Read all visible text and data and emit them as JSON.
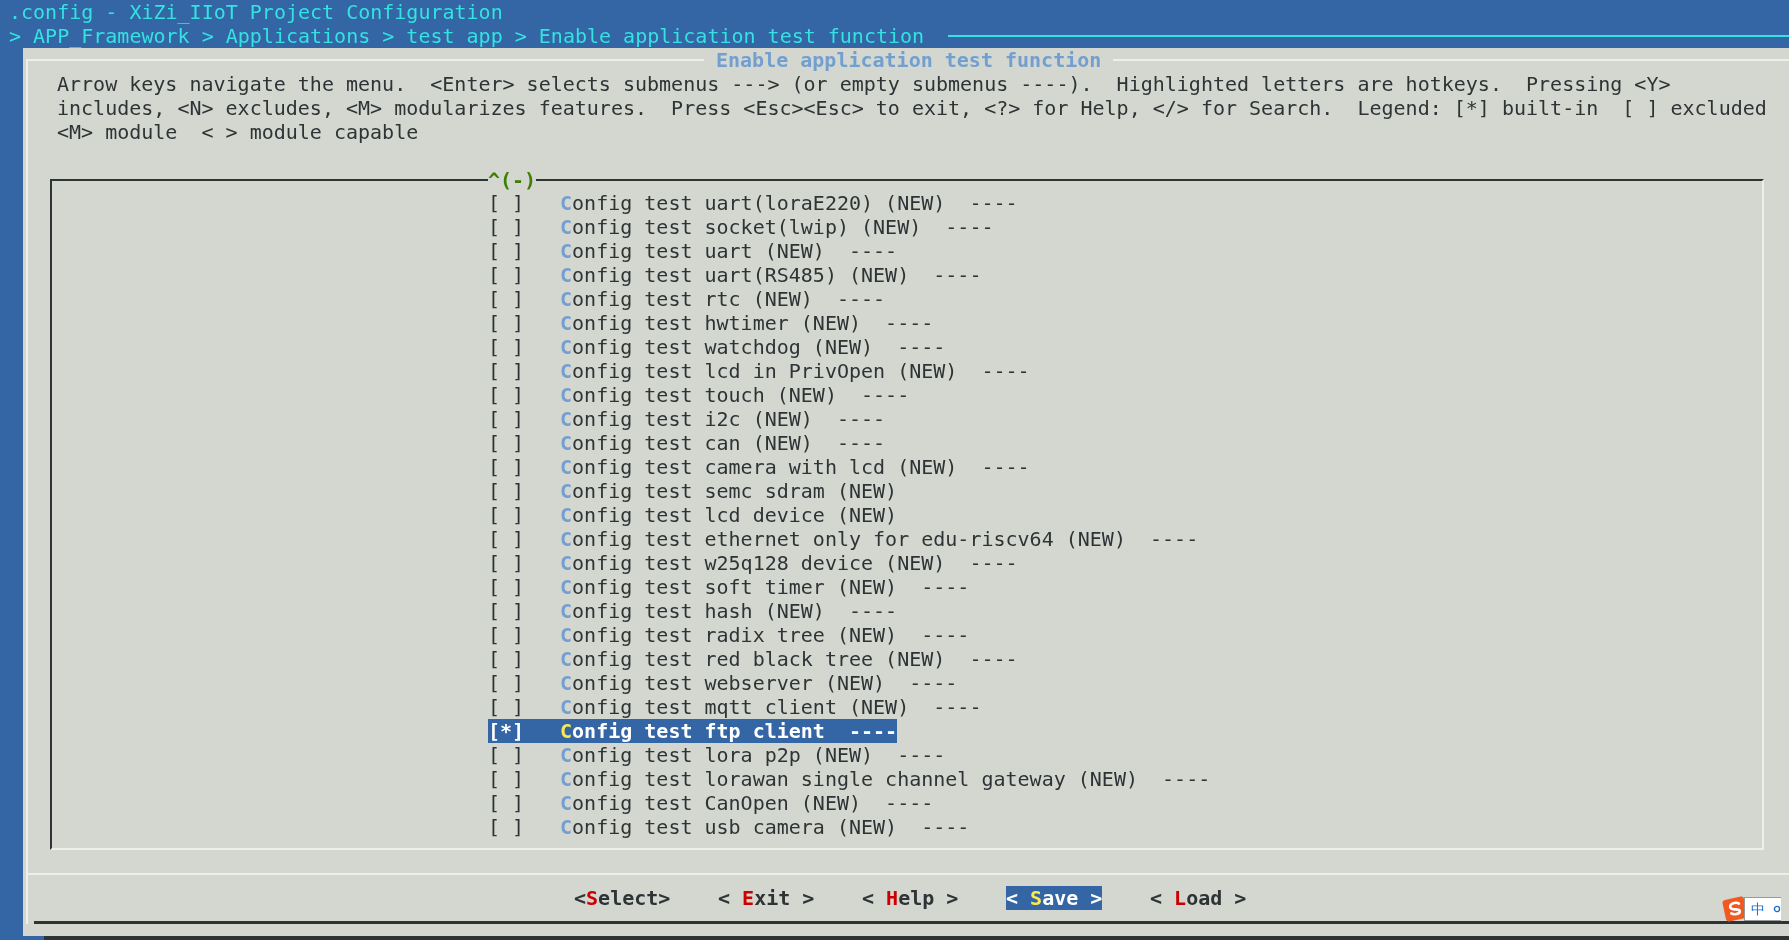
{
  "window": {
    "title": ".config - XiZi_IIoT Project Configuration"
  },
  "breadcrumb": "> APP_Framework > Applications > test app > Enable application test function",
  "dialog": {
    "title": "Enable application test function",
    "help": "Arrow keys navigate the menu.  <Enter> selects submenus ---> (or empty submenus ----).  Highlighted letters are hotkeys.  Pressing <Y>\nincludes, <N> excludes, <M> modularizes features.  Press <Esc><Esc> to exit, <?> for Help, </> for Search.  Legend: [*] built-in  [ ] excluded\n<M> module  < > module capable",
    "scroll_indicator": "^(-)",
    "items": [
      {
        "checkbox": "[ ]",
        "label": "Config test uart(loraE220) (NEW)  ----",
        "selected": false
      },
      {
        "checkbox": "[ ]",
        "label": "Config test socket(lwip) (NEW)  ----",
        "selected": false
      },
      {
        "checkbox": "[ ]",
        "label": "Config test uart (NEW)  ----",
        "selected": false
      },
      {
        "checkbox": "[ ]",
        "label": "Config test uart(RS485) (NEW)  ----",
        "selected": false
      },
      {
        "checkbox": "[ ]",
        "label": "Config test rtc (NEW)  ----",
        "selected": false
      },
      {
        "checkbox": "[ ]",
        "label": "Config test hwtimer (NEW)  ----",
        "selected": false
      },
      {
        "checkbox": "[ ]",
        "label": "Config test watchdog (NEW)  ----",
        "selected": false
      },
      {
        "checkbox": "[ ]",
        "label": "Config test lcd in PrivOpen (NEW)  ----",
        "selected": false
      },
      {
        "checkbox": "[ ]",
        "label": "Config test touch (NEW)  ----",
        "selected": false
      },
      {
        "checkbox": "[ ]",
        "label": "Config test i2c (NEW)  ----",
        "selected": false
      },
      {
        "checkbox": "[ ]",
        "label": "Config test can (NEW)  ----",
        "selected": false
      },
      {
        "checkbox": "[ ]",
        "label": "Config test camera with lcd (NEW)  ----",
        "selected": false
      },
      {
        "checkbox": "[ ]",
        "label": "Config test semc sdram (NEW)",
        "selected": false
      },
      {
        "checkbox": "[ ]",
        "label": "Config test lcd device (NEW)",
        "selected": false
      },
      {
        "checkbox": "[ ]",
        "label": "Config test ethernet only for edu-riscv64 (NEW)  ----",
        "selected": false
      },
      {
        "checkbox": "[ ]",
        "label": "Config test w25q128 device (NEW)  ----",
        "selected": false
      },
      {
        "checkbox": "[ ]",
        "label": "Config test soft timer (NEW)  ----",
        "selected": false
      },
      {
        "checkbox": "[ ]",
        "label": "Config test hash (NEW)  ----",
        "selected": false
      },
      {
        "checkbox": "[ ]",
        "label": "Config test radix tree (NEW)  ----",
        "selected": false
      },
      {
        "checkbox": "[ ]",
        "label": "Config test red black tree (NEW)  ----",
        "selected": false
      },
      {
        "checkbox": "[ ]",
        "label": "Config test webserver (NEW)  ----",
        "selected": false
      },
      {
        "checkbox": "[ ]",
        "label": "Config test mqtt client (NEW)  ----",
        "selected": false
      },
      {
        "checkbox": "[*]",
        "label": "Config test ftp client  ----",
        "selected": true
      },
      {
        "checkbox": "[ ]",
        "label": "Config test lora p2p (NEW)  ----",
        "selected": false
      },
      {
        "checkbox": "[ ]",
        "label": "Config test lorawan single channel gateway (NEW)  ----",
        "selected": false
      },
      {
        "checkbox": "[ ]",
        "label": "Config test CanOpen (NEW)  ----",
        "selected": false
      },
      {
        "checkbox": "[ ]",
        "label": "Config test usb camera (NEW)  ----",
        "selected": false
      }
    ],
    "buttons": [
      {
        "label": "<Select>",
        "selected": false
      },
      {
        "label": "< Exit >",
        "selected": false
      },
      {
        "label": "< Help >",
        "selected": false
      },
      {
        "label": "< Save >",
        "selected": true
      },
      {
        "label": "< Load >",
        "selected": false
      }
    ]
  },
  "ime": {
    "mode": "中"
  }
}
